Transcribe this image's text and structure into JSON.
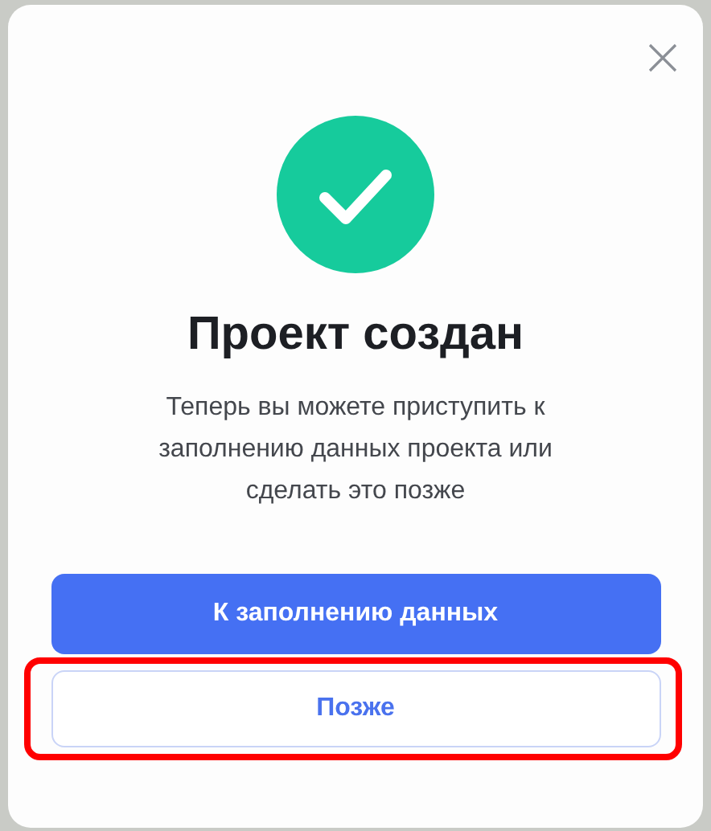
{
  "dialog": {
    "title": "Проект создан",
    "message": "Теперь вы можете приступить к заполнению данных проекта или сделать это позже",
    "buttons": [
      {
        "label": "К заполнению данных",
        "kind": "primary",
        "highlighted": false
      },
      {
        "label": "Позже",
        "kind": "secondary",
        "highlighted": true
      }
    ]
  }
}
